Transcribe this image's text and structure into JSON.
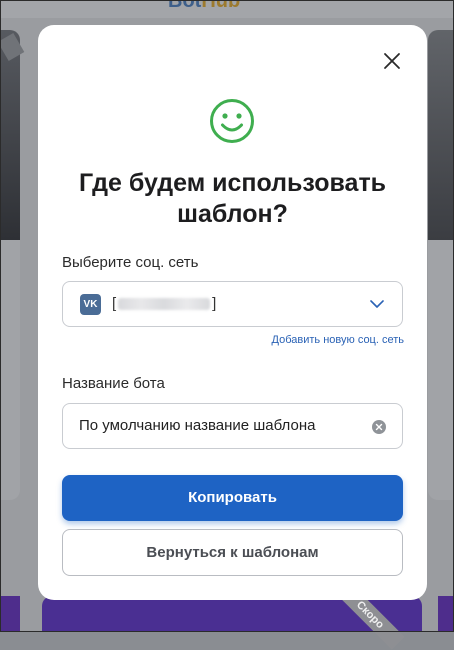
{
  "background": {
    "logo_part1": "Bot",
    "logo_part2": "Hub",
    "corner_ribbon": "Скоро"
  },
  "modal": {
    "close_icon": "close-icon",
    "smiley_icon": "smiley-icon",
    "title": "Где будем использовать шаблон?",
    "social": {
      "label": "Выберите соц. сеть",
      "network_badge": "VK",
      "value_prefix": "[",
      "value_suffix": "]",
      "add_link": "Добавить новую соц. сеть"
    },
    "bot_name": {
      "label": "Название бота",
      "value": "По умолчанию название шаблона"
    },
    "copy_button": "Копировать",
    "back_button": "Вернуться к шаблонам"
  },
  "colors": {
    "accent": "#1e63c4",
    "smiley": "#3fae4f",
    "link": "#2a62b5"
  }
}
